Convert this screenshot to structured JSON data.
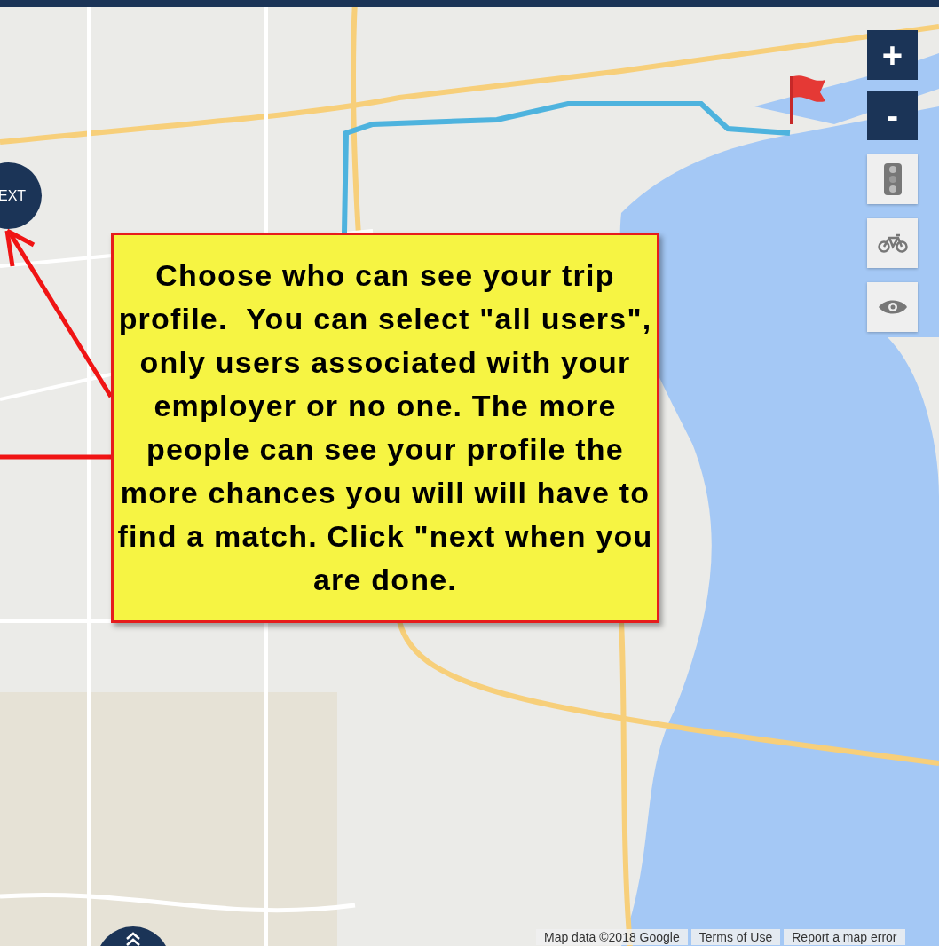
{
  "next_button": {
    "label": "EXT"
  },
  "callout": {
    "text": "Choose who can see your trip profile.  You can select \"all users\", only users associated with your employer or no one. The more people can see your profile the more chances you will will have to find a match. Click \"next when you are done."
  },
  "zoom_controls": [
    {
      "label": "+"
    },
    {
      "label": "-"
    }
  ],
  "layer_buttons": [
    {
      "kind": "traffic"
    },
    {
      "kind": "bike"
    },
    {
      "kind": "eye"
    }
  ],
  "footer": [
    "Map data ©2018 Google",
    "Terms of Use",
    "Report a map error"
  ]
}
